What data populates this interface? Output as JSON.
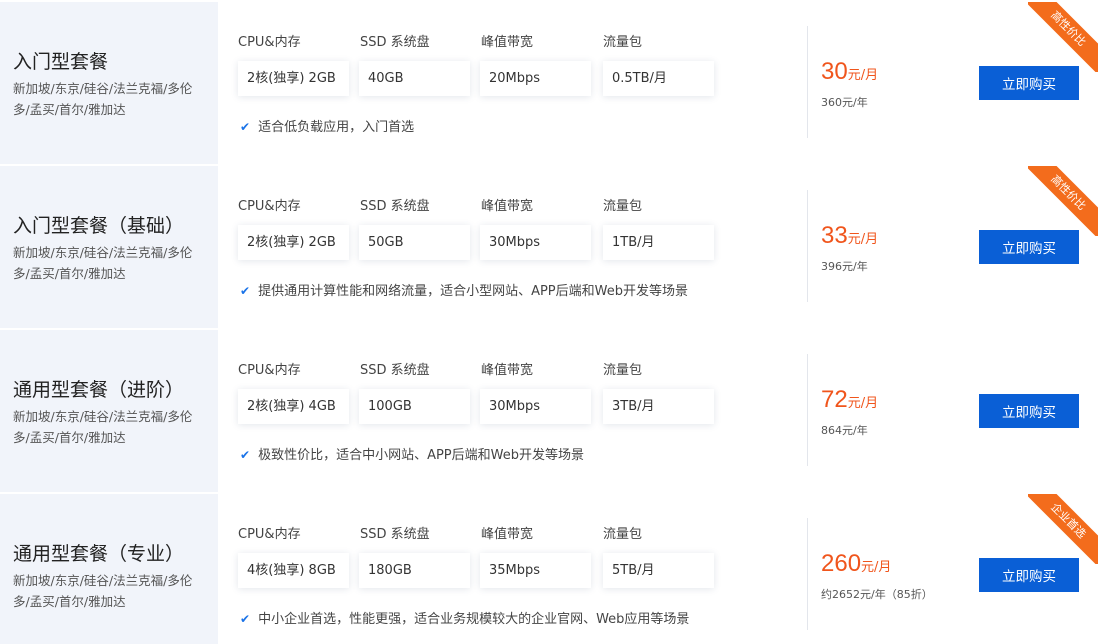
{
  "spec_labels": [
    "CPU&内存",
    "SSD 系统盘",
    "峰值带宽",
    "流量包"
  ],
  "buy_label": "立即购买",
  "check_icon": "check-icon",
  "colors": {
    "accent": "#0a5fd6",
    "price": "#f0551c",
    "ribbon": "#f36c1c",
    "left_bg": "#f1f4fa"
  },
  "plans": [
    {
      "name": "入门型套餐",
      "regions": "新加坡/东京/硅谷/法兰克福/多伦多/孟买/首尔/雅加达",
      "cpu": "2核(独享) 2GB",
      "disk": "40GB",
      "bandwidth": "20Mbps",
      "traffic": "0.5TB/月",
      "feature": "适合低负载应用，入门首选",
      "price": "30",
      "price_unit": "元/月",
      "price_year": "360元/年",
      "ribbon": "高性价比"
    },
    {
      "name": "入门型套餐（基础）",
      "regions": "新加坡/东京/硅谷/法兰克福/多伦多/孟买/首尔/雅加达",
      "cpu": "2核(独享) 2GB",
      "disk": "50GB",
      "bandwidth": "30Mbps",
      "traffic": "1TB/月",
      "feature": "提供通用计算性能和网络流量，适合小型网站、APP后端和Web开发等场景",
      "price": "33",
      "price_unit": "元/月",
      "price_year": "396元/年",
      "ribbon": "高性价比"
    },
    {
      "name": "通用型套餐（进阶）",
      "regions": "新加坡/东京/硅谷/法兰克福/多伦多/孟买/首尔/雅加达",
      "cpu": "2核(独享) 4GB",
      "disk": "100GB",
      "bandwidth": "30Mbps",
      "traffic": "3TB/月",
      "feature": "极致性价比，适合中小网站、APP后端和Web开发等场景",
      "price": "72",
      "price_unit": "元/月",
      "price_year": "864元/年",
      "ribbon": ""
    },
    {
      "name": "通用型套餐（专业）",
      "regions": "新加坡/东京/硅谷/法兰克福/多伦多/孟买/首尔/雅加达",
      "cpu": "4核(独享) 8GB",
      "disk": "180GB",
      "bandwidth": "35Mbps",
      "traffic": "5TB/月",
      "feature": "中小企业首选，性能更强，适合业务规模较大的企业官网、Web应用等场景",
      "price": "260",
      "price_unit": "元/月",
      "price_year": "约2652元/年（85折）",
      "ribbon": "企业首选"
    }
  ]
}
